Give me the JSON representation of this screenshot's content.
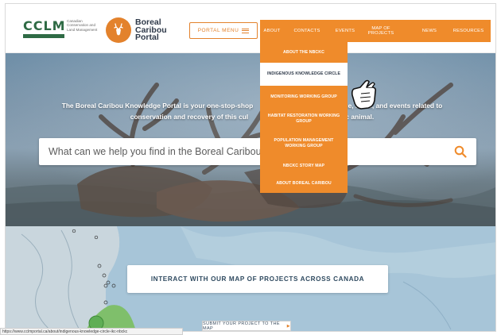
{
  "header": {
    "cclm": {
      "letters": "CCLM",
      "subtitle": "Canadian Conservation and Land Management"
    },
    "brand": {
      "line1": "Boreal",
      "line2": "Caribou",
      "line3": "Portal"
    },
    "portal_menu_label": "PORTAL MENU"
  },
  "nav": {
    "items": [
      {
        "label": "ABOUT"
      },
      {
        "label": "CONTACTS"
      },
      {
        "label": "EVENTS"
      },
      {
        "label": "MAP OF PROJECTS"
      },
      {
        "label": "NEWS"
      },
      {
        "label": "RESOURCES"
      }
    ]
  },
  "dropdown": {
    "items": [
      {
        "label": "ABOUT THE NBCKC"
      },
      {
        "label": "INDIGENOUS KNOWLEDGE CIRCLE"
      },
      {
        "label": "MONITORING WORKING GROUP"
      },
      {
        "label": "HABITAT RESTORATION WORKING GROUP"
      },
      {
        "label": "POPULATION MANAGEMENT WORKING GROUP"
      },
      {
        "label": "NBCKC STORY MAP"
      },
      {
        "label": "ABOUT BOREAL CARIBOU"
      }
    ]
  },
  "hero": {
    "line1_a": "The Boreal Caribou Knowledge Portal is your one-stop-shop",
    "line1_b": "ce, news, and events related to",
    "line2_a": "conservation and recovery of this cul",
    "line2_b": "nic animal.",
    "search_placeholder": "What can we help you find in the Boreal Caribou"
  },
  "map": {
    "cta_label": "INTERACT WITH OUR MAP OF PROJECTS ACROSS CANADA",
    "submit_label": "SUBMIT YOUR PROJECT TO THE MAP"
  },
  "status_bar": {
    "url": "https://www.cclmportal.ca/about/indigenous-knowledge-circle-ikc-nbckc"
  },
  "colors": {
    "accent": "#ef8b2b",
    "brand_green": "#2f6b45",
    "navy_text": "#2f3a4a"
  }
}
